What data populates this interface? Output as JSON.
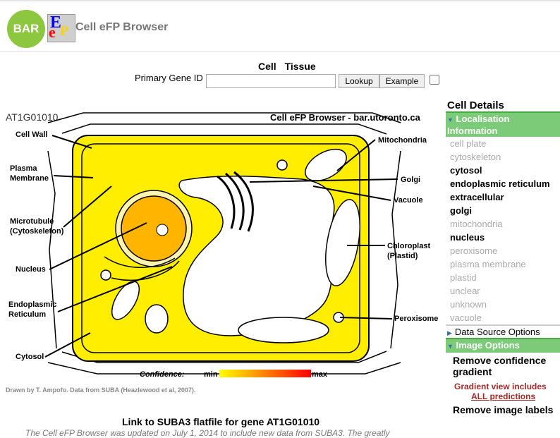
{
  "header": {
    "logo_text": "BAR",
    "efp_logo": {
      "big": "E",
      "e": "e",
      "p": "P"
    },
    "app_title": "Cell eFP Browser"
  },
  "view_nav": {
    "items": [
      "Cell",
      "Tissue"
    ]
  },
  "search": {
    "label": "Primary Gene ID",
    "value": "",
    "lookup_label": "Lookup",
    "example_label": "Example"
  },
  "gene_id": "AT1G01010",
  "diagram": {
    "title": "Cell eFP Browser - bar.utoronto.ca",
    "labels": {
      "cell_wall": "Cell Wall",
      "plasma_membrane_1": "Plasma",
      "plasma_membrane_2": "Membrane",
      "microtubule_1": "Microtubule",
      "microtubule_2": "(Cytoskeleton)",
      "nucleus": "Nucleus",
      "er_1": "Endoplasmic",
      "er_2": "Reticulum",
      "cytosol": "Cytosol",
      "mitochondria": "Mitochondria",
      "golgi": "Golgi",
      "vacuole": "Vacuole",
      "chloroplast_1": "Chloroplast",
      "chloroplast_2": "(Plastid)",
      "peroxisome": "Peroxisome"
    },
    "confidence": {
      "label": "Confidence:",
      "min": "min",
      "max": "max"
    },
    "colors": {
      "cell_fill": "#ffee00",
      "nucleus_fill": "#ffb400",
      "outline": "#000000",
      "min": "#ffff00",
      "max": "#ff0000"
    }
  },
  "credit": "Drawn by T. Ampofo. Data from SUBA (Heazlewood et al, 2007).",
  "link_text": "Link to SUBA3 flatfile for gene AT1G01010",
  "bottom_text": "The Cell eFP Browser was updated on July 1, 2014 to include new data from SUBA3. The greatly",
  "sidebar": {
    "title": "Cell Details",
    "localisation": {
      "header": "Localisation Information",
      "items": [
        {
          "label": "cell plate",
          "strong": false
        },
        {
          "label": "cytoskeleton",
          "strong": false
        },
        {
          "label": "cytosol",
          "strong": true
        },
        {
          "label": "endoplasmic reticulum",
          "strong": true
        },
        {
          "label": "extracellular",
          "strong": true
        },
        {
          "label": "golgi",
          "strong": true
        },
        {
          "label": "mitochondria",
          "strong": false
        },
        {
          "label": "nucleus",
          "strong": true
        },
        {
          "label": "peroxisome",
          "strong": false
        },
        {
          "label": "plasma membrane",
          "strong": false
        },
        {
          "label": "plastid",
          "strong": false
        },
        {
          "label": "unclear",
          "strong": false
        },
        {
          "label": "unknown",
          "strong": false
        },
        {
          "label": "vacuole",
          "strong": false
        }
      ]
    },
    "data_source_options": "Data Source Options",
    "image_options": {
      "header": "Image Options",
      "remove_confidence": "Remove confidence gradient",
      "gradient_view_1": "Gradient view includes",
      "gradient_view_2": "ALL predictions",
      "remove_labels": "Remove image labels"
    }
  }
}
